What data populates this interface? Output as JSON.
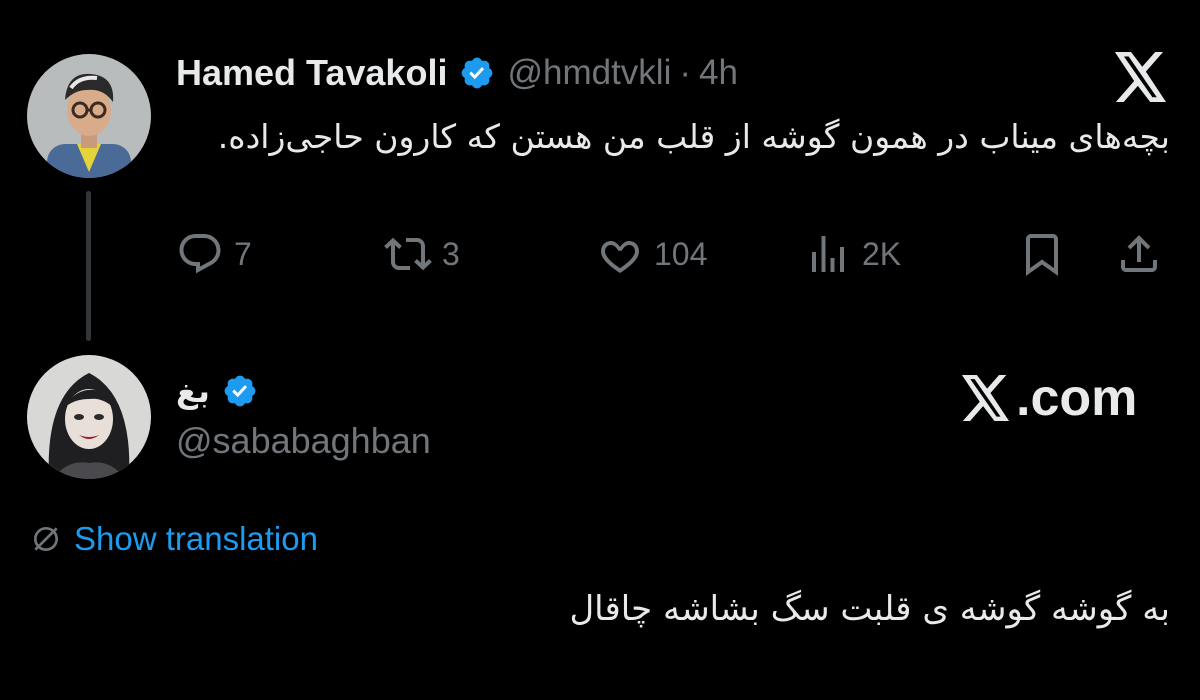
{
  "tweet1": {
    "display_name": "Hamed Tavakoli",
    "handle": "@hmdtvkli",
    "separator": "·",
    "time": "4h",
    "text": "بچه‌های میناب در همون گوشه از قلب من هستن که کارون حاجی‌زاده.",
    "actions": {
      "replies": "7",
      "retweets": "3",
      "likes": "104",
      "views": "2K"
    }
  },
  "tweet2": {
    "display_name": "بغ",
    "handle": "@sababaghban",
    "translation_label": "Show translation",
    "text": "به گوشه گوشه ی قلبت سگ بشاشه چاقال"
  },
  "watermark": {
    "text": ".com"
  },
  "icons": {
    "verified": "verified-badge-icon",
    "x_logo": "x-logo-icon",
    "reply": "reply-icon",
    "retweet": "retweet-icon",
    "like": "heart-icon",
    "views": "views-icon",
    "bookmark": "bookmark-icon",
    "share": "share-icon",
    "translate": "globe-slash-icon"
  },
  "colors": {
    "background": "#000000",
    "text": "#e7e9ea",
    "muted": "#71767b",
    "accent": "#1d9bf0"
  }
}
